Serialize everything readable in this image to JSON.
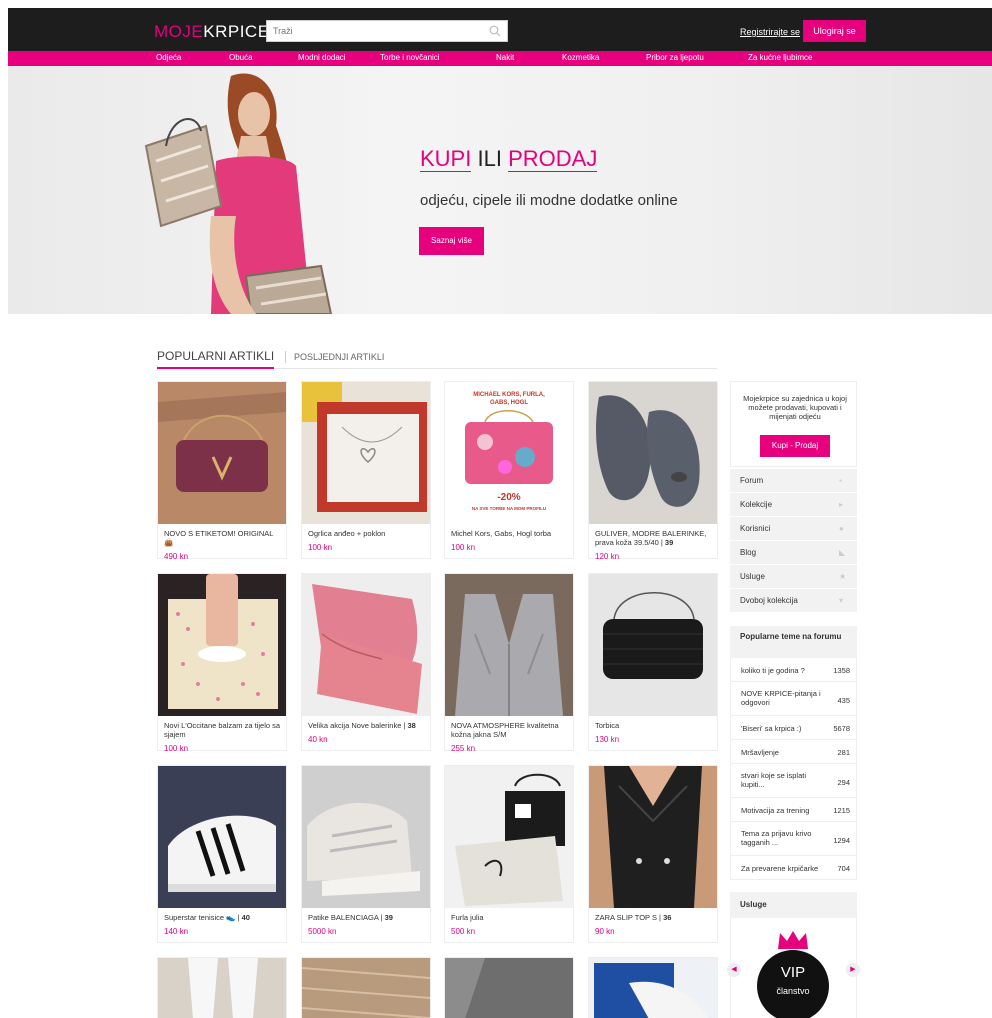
{
  "header": {
    "logo_part1": "MOJE",
    "logo_part2": "KRPICE",
    "search_placeholder": "Traži",
    "register_label": "Registrirajte se",
    "login_label": "Ulogiraj se"
  },
  "nav": {
    "items": [
      "Odjeća",
      "Obuća",
      "Modni dodaci",
      "Torbe i novčanici",
      "Nakit",
      "Kozmetika",
      "Pribor za ljepotu",
      "Za kućne ljubimce"
    ]
  },
  "hero": {
    "word1": "KUPI",
    "word2": "ILI",
    "word3": "PRODAJ",
    "subtitle": "odjeću, cipele ili modne dodatke online",
    "button": "Saznaj više"
  },
  "tabs": {
    "active": "POPULARNI ARTIKLI",
    "inactive": "POSLJEDNJI ARTIKLI"
  },
  "products": [
    {
      "title": "NOVO S ETIKETOM! ORIGINAL 👜",
      "size": "",
      "price": "490 kn"
    },
    {
      "title": "Ogrlica anđeo + poklon",
      "size": "",
      "price": "100 kn"
    },
    {
      "title": "Michel Kors, Gabs, Hogl torba",
      "size": "",
      "price": "100 kn"
    },
    {
      "title": "GULIVER, MODRE BALERINKE, prava koža 39.5/40 |",
      "size": "39",
      "price": "120 kn"
    },
    {
      "title": "Novi L'Occitane balzam za tijelo sa sjajem",
      "size": "",
      "price": "100 kn"
    },
    {
      "title": "Velika akcija Nove balerinke |",
      "size": "38",
      "price": "40 kn"
    },
    {
      "title": "NOVA ATMOSPHERE kvalitetna kožna jakna S/M",
      "size": "",
      "price": "255 kn"
    },
    {
      "title": "Torbica",
      "size": "",
      "price": "130 kn"
    },
    {
      "title": "Superstar tenisice 👟 |",
      "size": "40",
      "price": "140 kn"
    },
    {
      "title": "Patike BALENCIAGA |",
      "size": "39",
      "price": "5000 kn"
    },
    {
      "title": "Furla julia",
      "size": "",
      "price": "500 kn"
    },
    {
      "title": "ZARA SLIP TOP S |",
      "size": "36",
      "price": "90 kn"
    }
  ],
  "sidebar": {
    "intro_text": "Mojekrpice su zajednica u kojoj možete prodavati, kupovati i mijenjati odjeću",
    "intro_button": "Kupi - Prodaj",
    "menu": [
      "Forum",
      "Kolekcije",
      "Korisnici",
      "Blog",
      "Usluge",
      "Dvoboj kolekcija"
    ],
    "forum_heading": "Popularne teme na forumu",
    "forum_topics": [
      {
        "title": "koliko ti je godina ?",
        "count": "1358"
      },
      {
        "title": "NOVE KRPICE-pitanja i odgovori",
        "count": "435"
      },
      {
        "title": "'Biseri' sa krpica :)",
        "count": "5678"
      },
      {
        "title": "Mršavljenje",
        "count": "281"
      },
      {
        "title": "stvari koje se isplati kupiti...",
        "count": "294"
      },
      {
        "title": "Motivacija za trening",
        "count": "1215"
      },
      {
        "title": "Tema za prijavu krivo tagganih ...",
        "count": "1294"
      },
      {
        "title": "Za prevarene krpičarke",
        "count": "704"
      }
    ],
    "usluge_heading": "Usluge",
    "vip_title": "VIP",
    "vip_sub": "članstvo"
  },
  "colors": {
    "accent": "#e6007e",
    "header_bg": "#1d1d1d"
  }
}
